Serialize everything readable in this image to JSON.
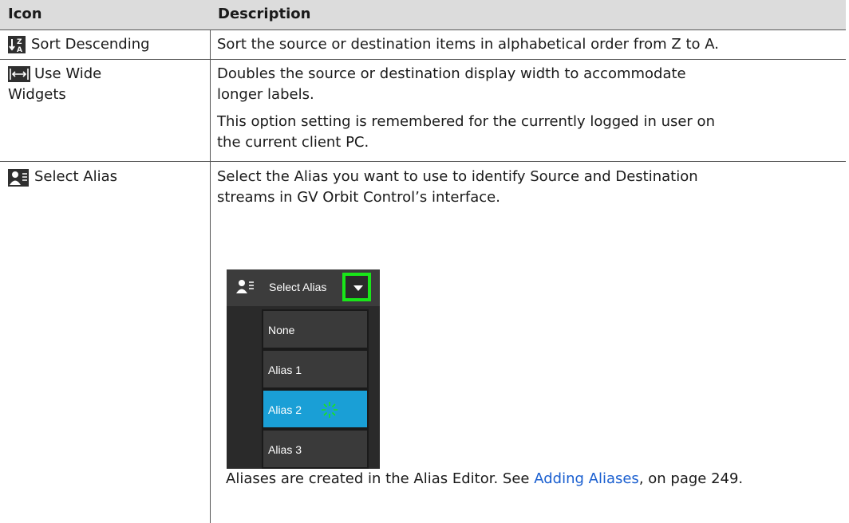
{
  "table": {
    "headers": [
      "Icon",
      "Description"
    ],
    "rows": [
      {
        "icon_name": "sort-descending-icon",
        "label": "Sort Descending",
        "description": [
          "Sort the source or destination items in alphabetical order from Z to A."
        ]
      },
      {
        "icon_name": "wide-widgets-icon",
        "label_line1": "Use Wide",
        "label_line2": "Widgets",
        "description": [
          "Doubles the source or destination display width to accommodate",
          "longer labels.",
          "This option setting is remembered for the currently logged in user on",
          "the current client PC."
        ]
      },
      {
        "icon_name": "select-alias-icon",
        "label": "Select Alias",
        "description": [
          "Select the Alias you want to use to identify Source and Destination",
          "streams in GV Orbit Control’s interface."
        ],
        "footer_prefix": "Aliases are created in the Alias Editor. See ",
        "footer_link": "Adding Aliases",
        "footer_suffix": ", on page 249."
      }
    ]
  },
  "dropdown_figure": {
    "selected_label": "Select Alias",
    "options": [
      "None",
      "Alias 1",
      "Alias 2",
      "Alias 3"
    ],
    "active_option": "Alias 2",
    "highlight_color": "#19e619",
    "active_color": "#1a9fd6"
  }
}
